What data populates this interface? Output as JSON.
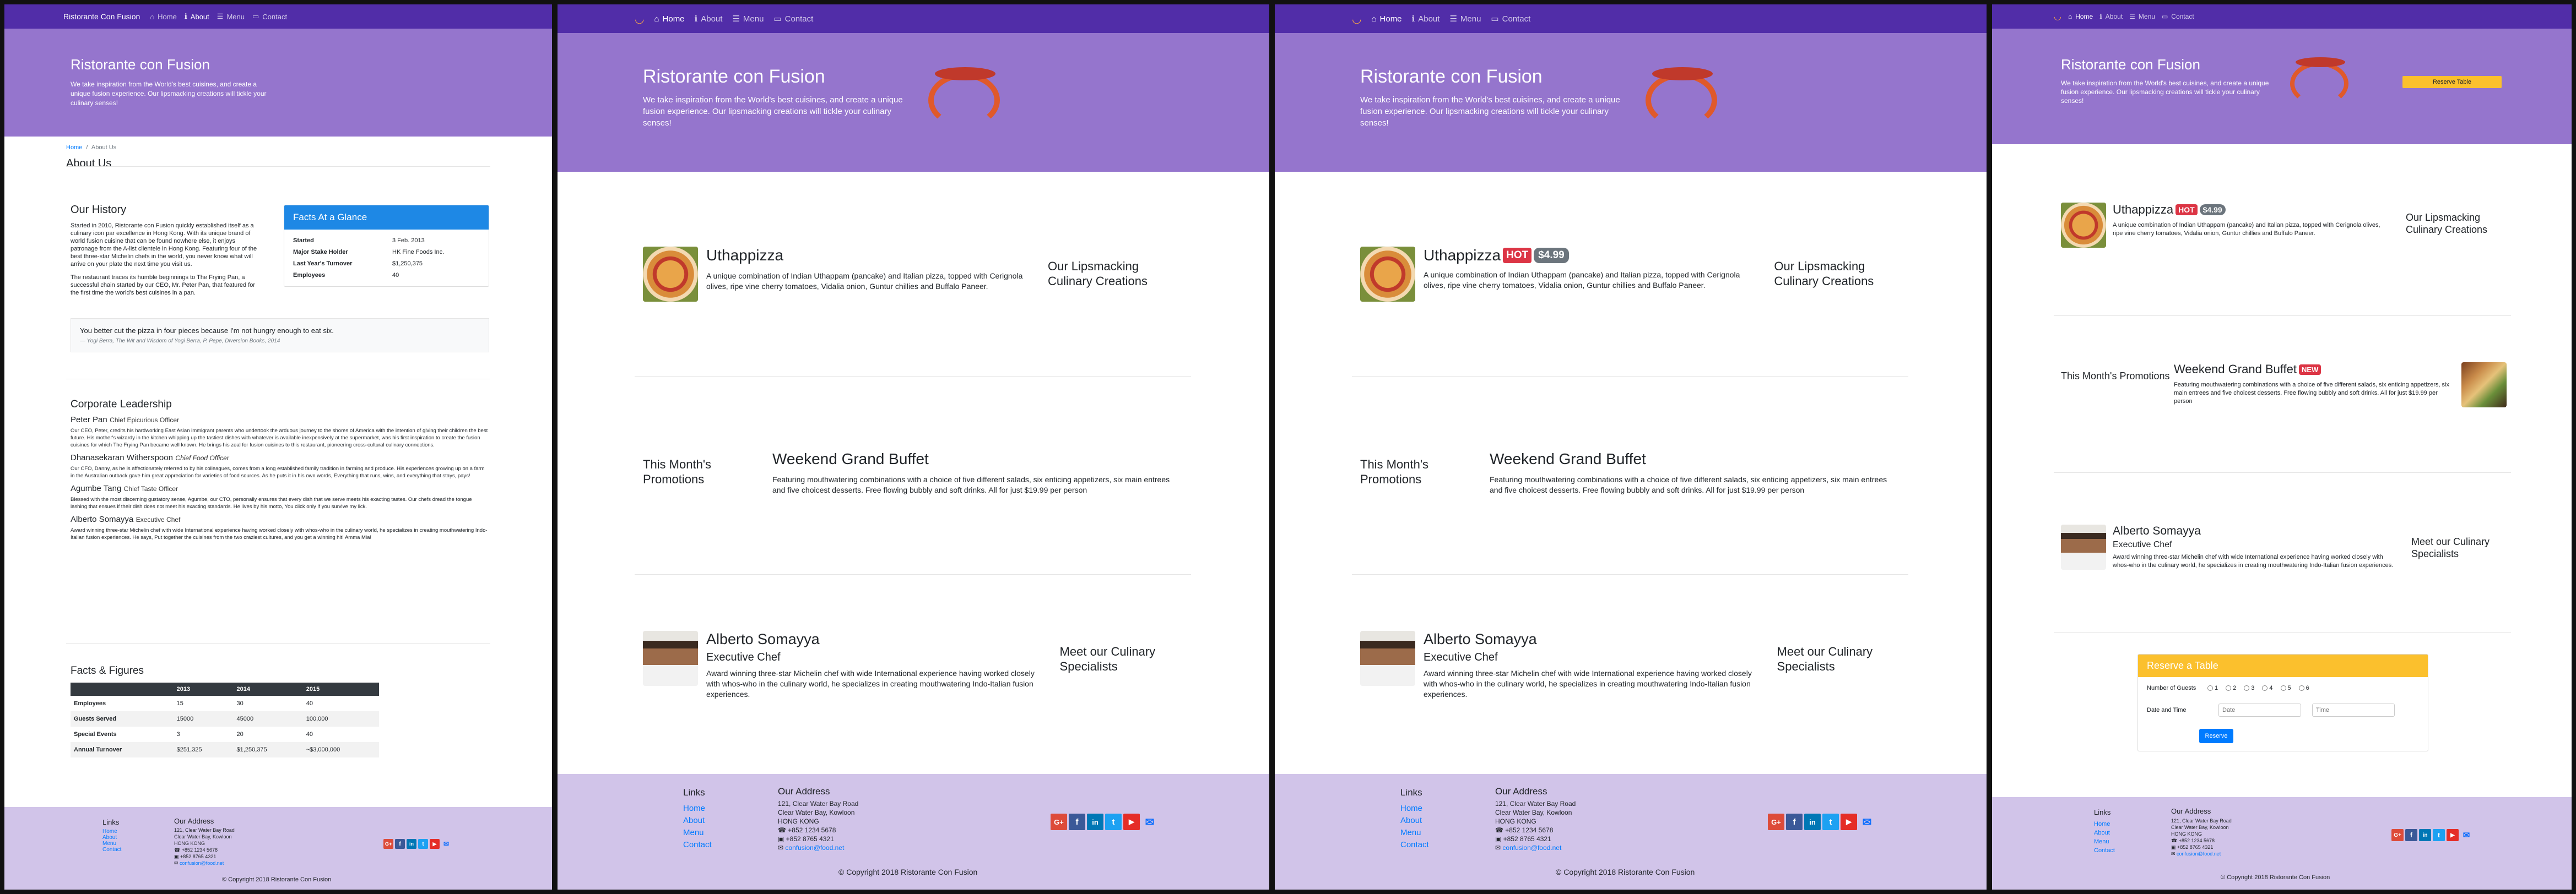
{
  "nav": {
    "brand": "Ristorante Con Fusion",
    "home": "Home",
    "about": "About",
    "menu": "Menu",
    "contact": "Contact"
  },
  "jumbotron": {
    "title": "Ristorante con Fusion",
    "text": "We take inspiration from the World's best cuisines, and create a unique fusion experience. Our lipsmacking creations will tickle your culinary senses!",
    "reserve_button": "Reserve Table"
  },
  "about": {
    "breadcrumb_home": "Home",
    "breadcrumb_sep": "/",
    "breadcrumb_current": "About Us",
    "heading": "About Us",
    "history_title": "Our History",
    "history_p1a": "Started in 2010, Ristorante con Fusion quickly established itself as a culinary icon par excellence in Hong Kong. With its unique brand of world fusion cuisine that can be found nowhere else, it enjoys patronage from the A-list clientele in Hong Kong. Featuring four of the best three-star Michelin chefs in the world, you never know what will arrive on your plate the next time you visit us.",
    "history_p2": "The restaurant traces its humble beginnings to The Frying Pan, a successful chain started by our CEO, Mr. Peter Pan, that featured for the first time the world's best cuisines in a pan.",
    "facts_title": "Facts At a Glance",
    "facts": [
      {
        "label": "Started",
        "value": "3 Feb. 2013"
      },
      {
        "label": "Major Stake Holder",
        "value": "HK Fine Foods Inc."
      },
      {
        "label": "Last Year's Turnover",
        "value": "$1,250,375"
      },
      {
        "label": "Employees",
        "value": "40"
      }
    ],
    "quote": "You better cut the pizza in four pieces because I'm not hungry enough to eat six.",
    "quote_source": "— Yogi Berra, The Wit and Wisdom of Yogi Berra, P. Pepe, Diversion Books, 2014",
    "leadership_title": "Corporate Leadership",
    "leaders": [
      {
        "name": "Peter Pan",
        "role": "Chief Epicurious Officer",
        "bio": "Our CEO, Peter, credits his hardworking East Asian immigrant parents who undertook the arduous journey to the shores of America with the intention of giving their children the best future. His mother's wizardy in the kitchen whipping up the tastiest dishes with whatever is available inexpensively at the supermarket, was his first inspiration to create the fusion cuisines for which The Frying Pan became well known. He brings his zeal for fusion cuisines to this restaurant, pioneering cross-cultural culinary connections."
      },
      {
        "name": "Dhanasekaran Witherspoon",
        "role": "Chief Food Officer",
        "bio": "Our CFO, Danny, as he is affectionately referred to by his colleagues, comes from a long established family tradition in farming and produce. His experiences growing up on a farm in the Australian outback gave him great appreciation for varieties of food sources. As he puts it in his own words, Everything that runs, wins, and everything that stays, pays!"
      },
      {
        "name": "Agumbe Tang",
        "role": "Chief Taste Officer",
        "bio": "Blessed with the most discerning gustatory sense, Agumbe, our CTO, personally ensures that every dish that we serve meets his exacting tastes. Our chefs dread the tongue lashing that ensues if their dish does not meet his exacting standards. He lives by his motto, You click only if you survive my lick."
      },
      {
        "name": "Alberto Somayya",
        "role": "Executive Chef",
        "bio": "Award winning three-star Michelin chef with wide International experience having worked closely with whos-who in the culinary world, he specializes in creating mouthwatering Indo-Italian fusion experiences. He says, Put together the cuisines from the two craziest cultures, and you get a winning hit! Amma Mia!"
      }
    ],
    "facts_figures_title": "Facts & Figures",
    "table": {
      "headers": [
        "",
        "2013",
        "2014",
        "2015"
      ],
      "rows": [
        [
          "Employees",
          "15",
          "30",
          "40"
        ],
        [
          "Guests Served",
          "15000",
          "45000",
          "100,000"
        ],
        [
          "Special Events",
          "3",
          "20",
          "40"
        ],
        [
          "Annual Turnover",
          "$251,325",
          "$1,250,375",
          "~$3,000,000"
        ]
      ]
    }
  },
  "home": {
    "dish_title": "Uthappizza",
    "dish_hot": "HOT",
    "dish_price": "$4.99",
    "dish_desc": "A unique combination of Indian Uthappam (pancake) and Italian pizza, topped with Cerignola olives, ripe vine cherry tomatoes, Vidalia onion, Guntur chillies and Buffalo Paneer.",
    "dish_side": "Our Lipsmacking Culinary Creations",
    "promo_side": "This Month's Promotions",
    "promo_title": "Weekend Grand Buffet",
    "promo_new": "NEW",
    "promo_desc": "Featuring mouthwatering combinations with a choice of five different salads, six enticing appetizers, six main entrees and five choicest desserts. Free flowing bubbly and soft drinks. All for just $19.99 per person",
    "leader_name": "Alberto Somayya",
    "leader_role": "Executive Chef",
    "leader_desc": "Award winning three-star Michelin chef with wide International experience having worked closely with whos-who in the culinary world, he specializes in creating mouthwatering Indo-Italian fusion experiences.",
    "leader_side": "Meet our Culinary Specialists"
  },
  "reserve": {
    "title": "Reserve a Table",
    "guests_label": "Number of Guests",
    "guests": [
      "1",
      "2",
      "3",
      "4",
      "5",
      "6"
    ],
    "datetime_label": "Date and Time",
    "date_placeholder": "Date",
    "time_placeholder": "Time",
    "button": "Reserve"
  },
  "footer": {
    "links_title": "Links",
    "links": [
      "Home",
      "About",
      "Menu",
      "Contact"
    ],
    "address_title": "Our Address",
    "address": [
      "121, Clear Water Bay Road",
      "Clear Water Bay, Kowloon",
      "HONG KONG"
    ],
    "phone": "+852 1234 5678",
    "fax": "+852 8765 4321",
    "email": "confusion@food.net",
    "copyright": "© Copyright 2018 Ristorante Con Fusion",
    "social_icons": [
      "google-plus-icon",
      "facebook-icon",
      "linkedin-icon",
      "twitter-icon",
      "youtube-icon",
      "mail-icon"
    ]
  },
  "colors": {
    "navbar": "#512da8",
    "jumbotron": "#9575cd",
    "footer": "#d1c4e9",
    "facts_header": "#1e88e5",
    "reserve_header": "#fbc02d",
    "table_dark": "#343a40"
  }
}
